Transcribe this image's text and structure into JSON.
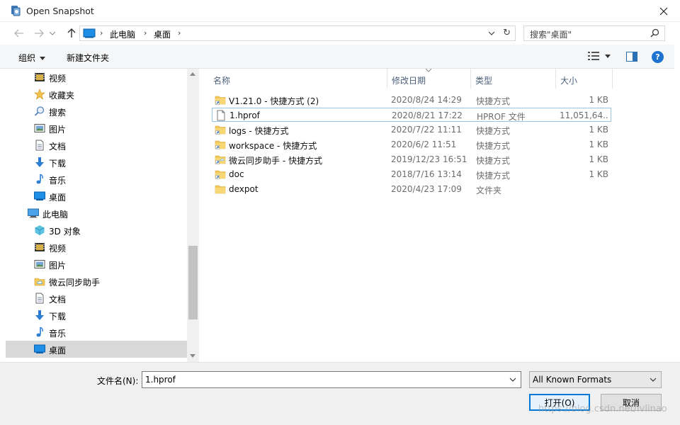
{
  "window": {
    "title": "Open Snapshot",
    "close_glyph": "✕"
  },
  "address": {
    "crumbs": [
      "此电脑",
      "桌面"
    ],
    "search_placeholder": "搜索\"桌面\""
  },
  "toolbar": {
    "organize_label": "组织",
    "new_folder_label": "新建文件夹"
  },
  "nav": {
    "items": [
      {
        "label": "视频",
        "icon": "video-icon"
      },
      {
        "label": "收藏夹",
        "icon": "star-icon"
      },
      {
        "label": "搜索",
        "icon": "search-icon"
      },
      {
        "label": "图片",
        "icon": "pictures-icon"
      },
      {
        "label": "文档",
        "icon": "documents-icon"
      },
      {
        "label": "下载",
        "icon": "download-icon"
      },
      {
        "label": "音乐",
        "icon": "music-icon"
      },
      {
        "label": "桌面",
        "icon": "desktop-icon"
      },
      {
        "label": "此电脑",
        "icon": "computer-icon"
      },
      {
        "label": "3D 对象",
        "icon": "3d-objects-icon"
      },
      {
        "label": "视频",
        "icon": "video-icon"
      },
      {
        "label": "图片",
        "icon": "pictures-icon"
      },
      {
        "label": "微云同步助手",
        "icon": "cloud-folder-icon"
      },
      {
        "label": "文档",
        "icon": "documents-icon"
      },
      {
        "label": "下载",
        "icon": "download-icon"
      },
      {
        "label": "音乐",
        "icon": "music-icon"
      },
      {
        "label": "桌面",
        "icon": "desktop-icon"
      }
    ]
  },
  "columns": {
    "name": "名称",
    "date": "修改日期",
    "type": "类型",
    "size": "大小"
  },
  "files": [
    {
      "name": "V1.21.0 - 快捷方式 (2)",
      "date": "2020/8/24 14:29",
      "type": "快捷方式",
      "size": "1 KB",
      "icon": "folder-shortcut-icon"
    },
    {
      "name": "1.hprof",
      "date": "2020/8/21 17:22",
      "type": "HPROF 文件",
      "size": "11,051,64...",
      "icon": "file-icon"
    },
    {
      "name": "logs - 快捷方式",
      "date": "2020/7/22 11:11",
      "type": "快捷方式",
      "size": "1 KB",
      "icon": "folder-shortcut-icon"
    },
    {
      "name": "workspace - 快捷方式",
      "date": "2020/6/2 11:51",
      "type": "快捷方式",
      "size": "1 KB",
      "icon": "folder-shortcut-icon"
    },
    {
      "name": "微云同步助手 - 快捷方式",
      "date": "2019/12/23 16:51",
      "type": "快捷方式",
      "size": "1 KB",
      "icon": "cloud-folder-shortcut-icon"
    },
    {
      "name": "doc",
      "date": "2018/7/16 13:14",
      "type": "快捷方式",
      "size": "1 KB",
      "icon": "folder-shortcut-icon"
    },
    {
      "name": "dexpot",
      "date": "2020/4/23 17:09",
      "type": "文件夹",
      "size": "",
      "icon": "folder-icon"
    }
  ],
  "bottom": {
    "filename_label": "文件名(N):",
    "filename_value": "1.hprof",
    "format_value": "All Known Formats",
    "open_label": "打开(O)",
    "cancel_label": "取消"
  },
  "watermark": "https://blog.csdn.net/lvlinao"
}
